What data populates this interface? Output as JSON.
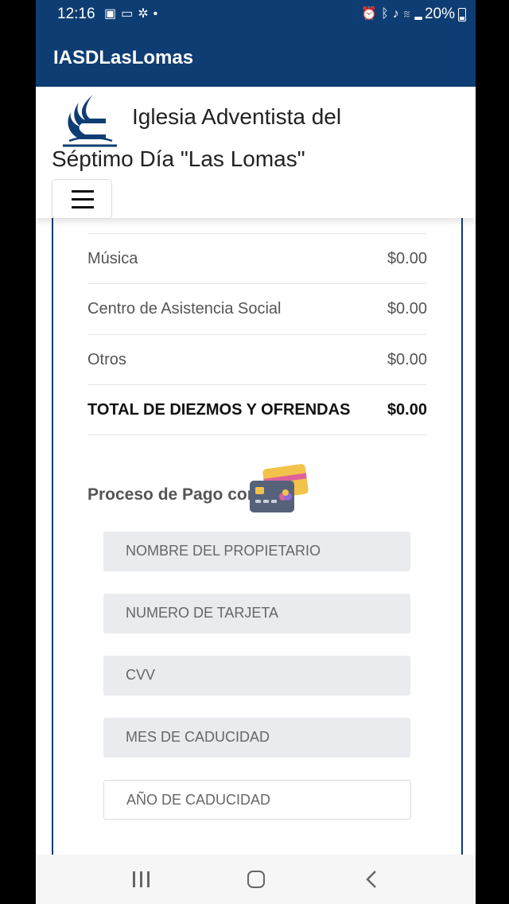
{
  "status_bar": {
    "time": "12:16",
    "left_icons": [
      "image-icon",
      "cast-icon",
      "fan-icon",
      "dot-icon"
    ],
    "right_icons": [
      "alarm-icon",
      "bluetooth-icon",
      "mute-icon",
      "wifi-icon",
      "signal-icon"
    ],
    "battery": "20%"
  },
  "app_bar": {
    "title": "IASDLasLomas"
  },
  "header": {
    "church_name_line1": "Iglesia Adventista del",
    "church_name_line2": "Séptimo Día \"Las Lomas\"",
    "logo_icon": "adventist-logo-icon",
    "menu_icon": "hamburger-menu-icon"
  },
  "summary_rows": [
    {
      "label": "Música",
      "value": "$0.00"
    },
    {
      "label": "Centro de Asistencia Social",
      "value": "$0.00"
    },
    {
      "label": "Otros",
      "value": "$0.00"
    },
    {
      "label": "TOTAL DE DIEZMOS Y OFRENDAS",
      "value": "$0.00"
    }
  ],
  "payment": {
    "label": "Proceso de Pago con",
    "card_icon": "credit-cards-icon",
    "fields": [
      {
        "placeholder": "NOMBRE DEL PROPIETARIO"
      },
      {
        "placeholder": "NUMERO DE TARJETA"
      },
      {
        "placeholder": "CVV"
      },
      {
        "placeholder": "MES DE CADUCIDAD"
      },
      {
        "placeholder": "AÑO DE CADUCIDAD"
      }
    ]
  },
  "colors": {
    "primary": "#0e3d73",
    "field_bg": "#e9ebee",
    "text_muted": "#555555"
  }
}
